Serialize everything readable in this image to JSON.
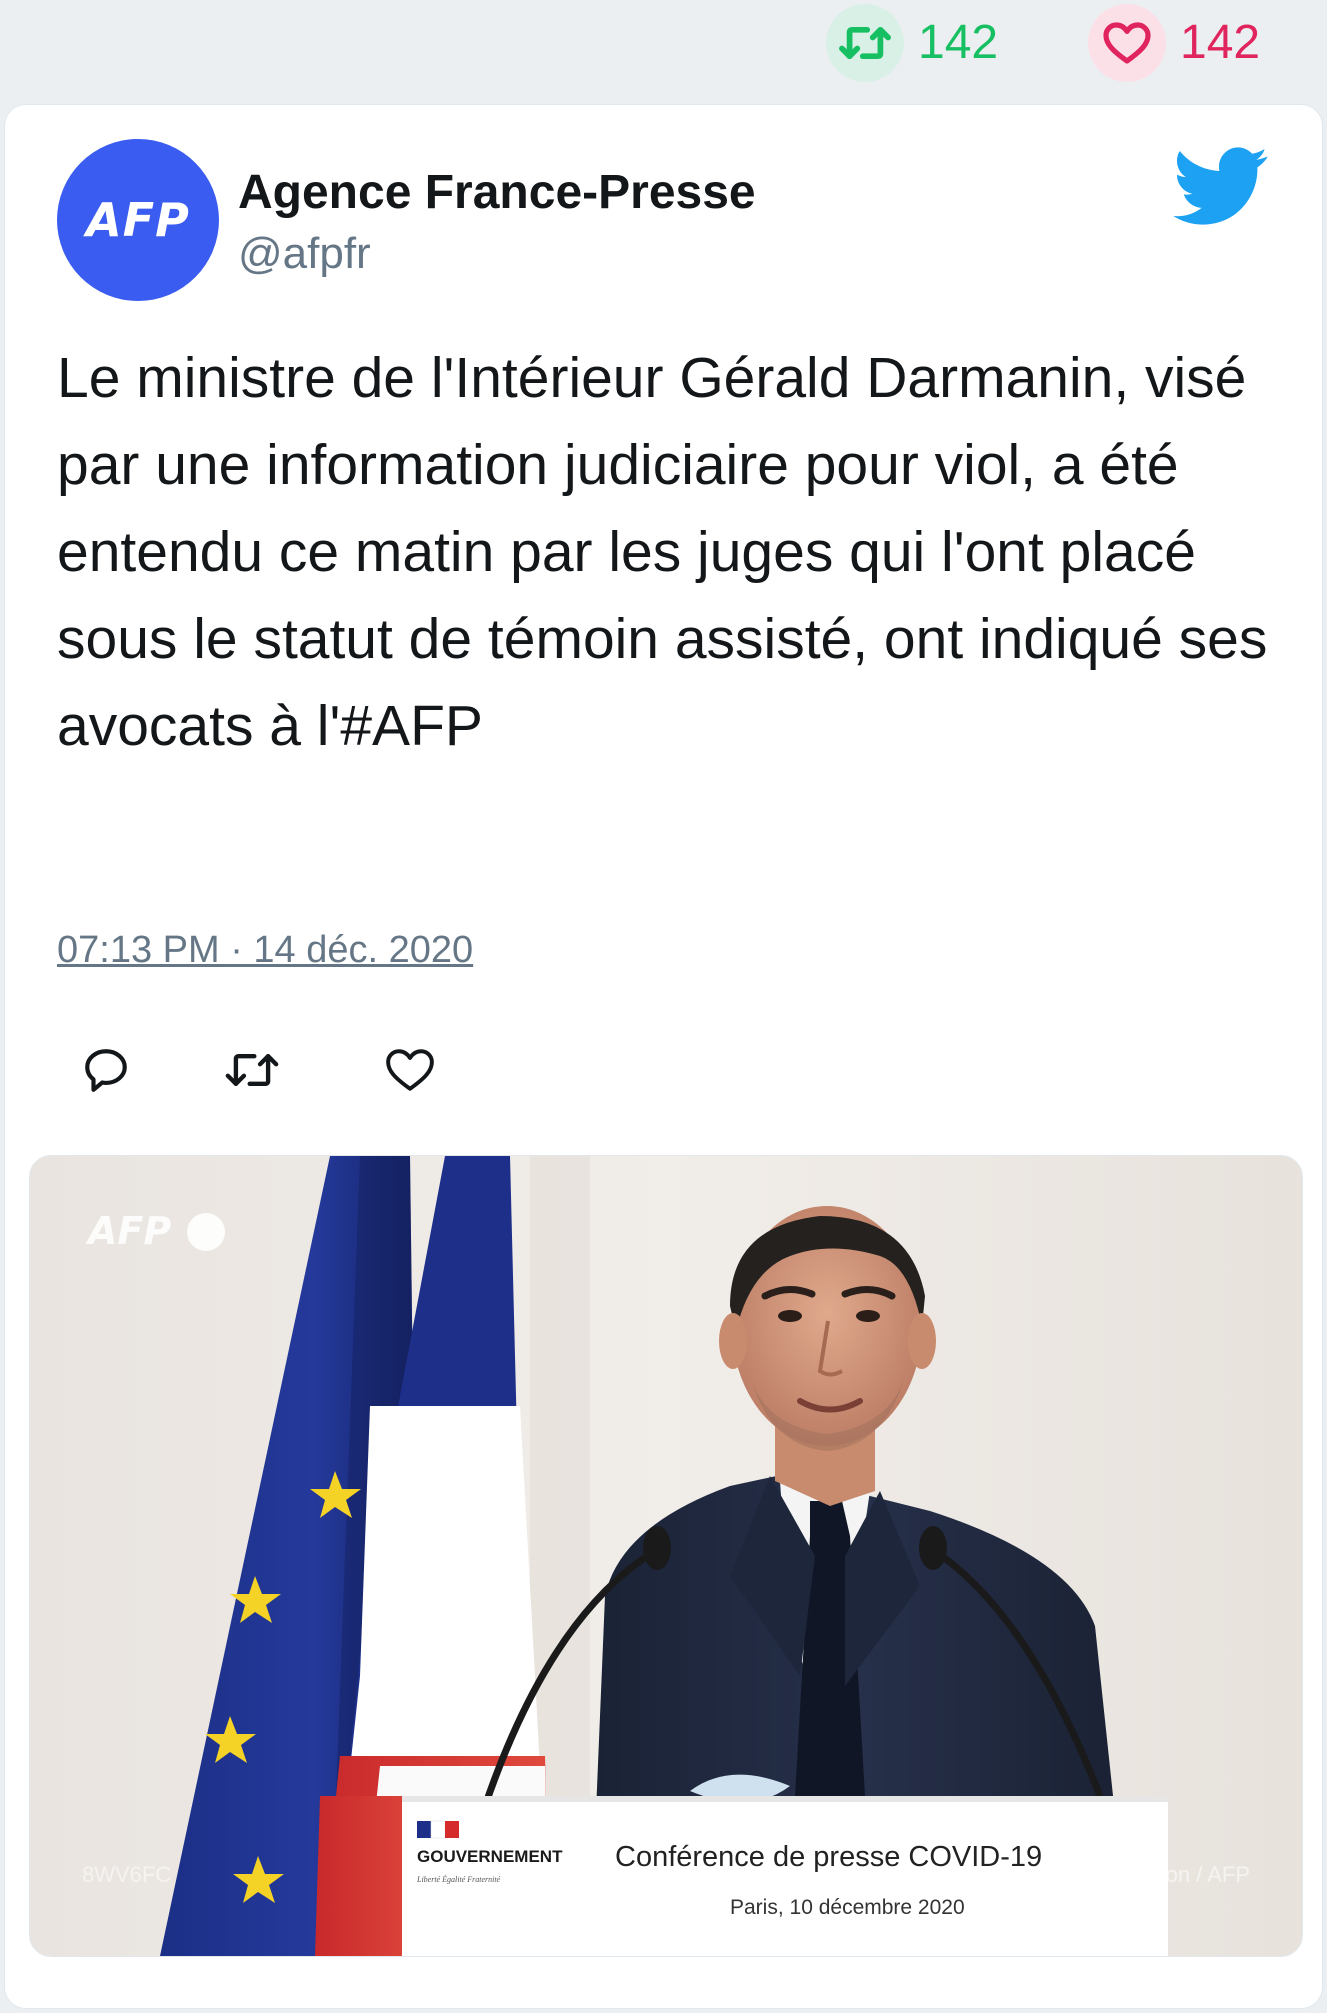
{
  "stats": {
    "retweet_count": "142",
    "like_count": "142",
    "retweet_icon": "retweet-icon",
    "like_icon": "heart-icon",
    "retweet_color": "#17bf63",
    "like_color": "#e0245e"
  },
  "tweet": {
    "author_name": "Agence France-Presse",
    "author_handle": "@afpfr",
    "avatar_text": "AFP",
    "avatar_color": "#3a5cf0",
    "text": "Le ministre de l'Intérieur Gérald Darmanin, visé par une information judiciaire pour viol, a été entendu ce matin par les juges qui l'ont placé sous le statut de témoin assisté, ont indiqué ses avocats à l'#AFP",
    "timestamp": "07:13 PM · 14 déc. 2020",
    "brand_icon": "twitter-bird-icon",
    "brand_color": "#1da1f2"
  },
  "actions": {
    "reply_icon": "reply-icon",
    "retweet_icon": "retweet-icon",
    "like_icon": "heart-icon"
  },
  "media": {
    "watermark_logo": "AFP",
    "podium_gov_label": "GOUVERNEMENT",
    "podium_motto": "Liberté Égalité Fraternité",
    "podium_title": "Conférence de presse COVID-19",
    "podium_subtitle": "Paris, 10 décembre 2020",
    "photo_id": "8WV6FC",
    "photo_credit": "Thomas Samson / AFP"
  }
}
